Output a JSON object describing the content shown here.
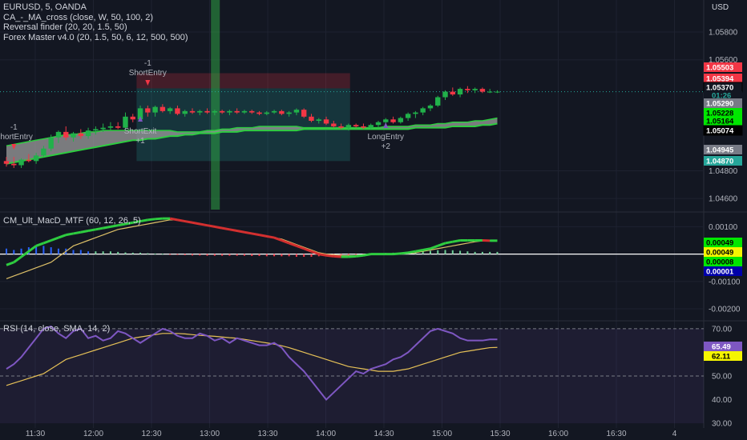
{
  "header": {
    "symbol_line": "EURUSD, 5, OANDA",
    "indicators": [
      "CA_-_MA_cross (close, W, 50, 100, 2)",
      "Reversal finder (20, 20, 1.5, 50)",
      "Forex Master v4.0 (20, 1.5, 50, 6, 12, 500, 500)"
    ],
    "currency": "USD"
  },
  "colors": {
    "background": "#131722",
    "bull": "#26a69a",
    "bull_candle": "#21b14a",
    "bear_candle": "#f23645",
    "macd_line": "#2ecc40",
    "signal_line": "#ddc068",
    "rsi_line": "#7e57c2",
    "rsi_ma": "#e6c157",
    "band_fill": "#9e9e9e",
    "grid": "#1e2230"
  },
  "chart_data": [
    {
      "type": "candlestick",
      "title": "EURUSD, 5, OANDA",
      "ylim": [
        1.0452,
        1.0595
      ],
      "y_ticks": [
        1.058,
        1.056,
        1.048,
        1.046
      ],
      "x_ticks": [
        "11:30",
        "12:00",
        "12:30",
        "13:00",
        "13:30",
        "14:00",
        "14:30",
        "15:00",
        "15:30",
        "16:00",
        "16:30",
        "4"
      ],
      "price_tags": [
        {
          "label": "1.05503",
          "value": 1.05503,
          "color": "#f23645"
        },
        {
          "label": "1.05394",
          "value": 1.05394,
          "color": "#f23645"
        },
        {
          "label": "1.05370",
          "value": 1.0537,
          "color": "#131722",
          "sub": "01:26"
        },
        {
          "label": "1.05290",
          "value": 1.0529,
          "color": "#787b86"
        },
        {
          "label": "1.05228",
          "value": 1.05228,
          "color": "#00e600"
        },
        {
          "label": "1.05164",
          "value": 1.05164,
          "color": "#00e600"
        },
        {
          "label": "1.05074",
          "value": 1.05074,
          "color": "#000000"
        },
        {
          "label": "1.04945",
          "value": 1.04945,
          "color": "#787b86"
        },
        {
          "label": "1.04870",
          "value": 1.0487,
          "color": "#26a69a"
        }
      ],
      "signals": [
        {
          "label": "-1",
          "label2": "ShortEntry",
          "time_index": 19,
          "kind": "sell"
        },
        {
          "label": "ShortExit",
          "label2": "+1",
          "time_index": 18,
          "kind": "exit"
        },
        {
          "label": "-1",
          "label2": "ShortEntry",
          "time_index": 1,
          "kind": "sell"
        },
        {
          "label": "LongEntry",
          "label2": "+2",
          "time_index": 51,
          "kind": "buy"
        }
      ],
      "ohlc": [
        [
          1.0487,
          1.049,
          1.0483,
          1.0485
        ],
        [
          1.0485,
          1.049,
          1.0482,
          1.0484
        ],
        [
          1.0484,
          1.0489,
          1.0482,
          1.0488
        ],
        [
          1.0488,
          1.0492,
          1.0486,
          1.0487
        ],
        [
          1.0487,
          1.0493,
          1.0485,
          1.0491
        ],
        [
          1.0491,
          1.0498,
          1.049,
          1.0496
        ],
        [
          1.0496,
          1.0506,
          1.0494,
          1.0504
        ],
        [
          1.0504,
          1.0509,
          1.05,
          1.0508
        ],
        [
          1.0508,
          1.0512,
          1.0502,
          1.0504
        ],
        [
          1.0504,
          1.0508,
          1.0501,
          1.0507
        ],
        [
          1.0507,
          1.051,
          1.0503,
          1.0505
        ],
        [
          1.0505,
          1.0511,
          1.0503,
          1.0509
        ],
        [
          1.0509,
          1.0512,
          1.0506,
          1.051
        ],
        [
          1.051,
          1.0514,
          1.0508,
          1.0511
        ],
        [
          1.0511,
          1.0515,
          1.0509,
          1.0512
        ],
        [
          1.0512,
          1.0515,
          1.051,
          1.0511
        ],
        [
          1.0511,
          1.0522,
          1.051,
          1.0519
        ],
        [
          1.0519,
          1.0521,
          1.0515,
          1.0517
        ],
        [
          1.0517,
          1.0527,
          1.0516,
          1.0525
        ],
        [
          1.0525,
          1.0527,
          1.0519,
          1.0522
        ],
        [
          1.0522,
          1.0527,
          1.0519,
          1.0526
        ],
        [
          1.0526,
          1.0528,
          1.0522,
          1.0523
        ],
        [
          1.0523,
          1.0526,
          1.0521,
          1.0525
        ],
        [
          1.0525,
          1.0527,
          1.052,
          1.0521
        ],
        [
          1.0521,
          1.0524,
          1.0519,
          1.0523
        ],
        [
          1.0523,
          1.0525,
          1.0521,
          1.0522
        ],
        [
          1.0522,
          1.0524,
          1.052,
          1.0523
        ],
        [
          1.0523,
          1.0525,
          1.0521,
          1.0522
        ],
        [
          1.0522,
          1.0524,
          1.052,
          1.0523
        ],
        [
          1.0523,
          1.0524,
          1.0521,
          1.0522
        ],
        [
          1.0522,
          1.0524,
          1.052,
          1.0523
        ],
        [
          1.0523,
          1.0525,
          1.0521,
          1.0522
        ],
        [
          1.0522,
          1.0524,
          1.0521,
          1.0523
        ],
        [
          1.0523,
          1.0524,
          1.0521,
          1.0522
        ],
        [
          1.0522,
          1.0523,
          1.052,
          1.0521
        ],
        [
          1.0521,
          1.0523,
          1.052,
          1.0522
        ],
        [
          1.0522,
          1.0524,
          1.0521,
          1.0523
        ],
        [
          1.0523,
          1.0524,
          1.052,
          1.0521
        ],
        [
          1.0521,
          1.0523,
          1.0519,
          1.0522
        ],
        [
          1.0522,
          1.0525,
          1.052,
          1.0524
        ],
        [
          1.0524,
          1.0525,
          1.0518,
          1.0519
        ],
        [
          1.0519,
          1.0521,
          1.0515,
          1.0516
        ],
        [
          1.0516,
          1.0518,
          1.0514,
          1.0517
        ],
        [
          1.0517,
          1.0519,
          1.0513,
          1.0514
        ],
        [
          1.0514,
          1.0516,
          1.0511,
          1.0512
        ],
        [
          1.0512,
          1.0514,
          1.051,
          1.0511
        ],
        [
          1.0511,
          1.0514,
          1.0509,
          1.0513
        ],
        [
          1.0513,
          1.0514,
          1.0511,
          1.0512
        ],
        [
          1.0512,
          1.0514,
          1.051,
          1.0511
        ],
        [
          1.0511,
          1.0514,
          1.051,
          1.0513
        ],
        [
          1.0513,
          1.0516,
          1.0511,
          1.0515
        ],
        [
          1.0515,
          1.0518,
          1.0513,
          1.0517
        ],
        [
          1.0517,
          1.0519,
          1.0514,
          1.0515
        ],
        [
          1.0515,
          1.0519,
          1.0514,
          1.0518
        ],
        [
          1.0518,
          1.0522,
          1.0516,
          1.0521
        ],
        [
          1.0521,
          1.0523,
          1.0518,
          1.0522
        ],
        [
          1.0522,
          1.0526,
          1.052,
          1.0525
        ],
        [
          1.0525,
          1.0528,
          1.0523,
          1.0527
        ],
        [
          1.0527,
          1.0534,
          1.0526,
          1.0533
        ],
        [
          1.0533,
          1.0538,
          1.0531,
          1.0537
        ],
        [
          1.0537,
          1.054,
          1.0534,
          1.0535
        ],
        [
          1.0535,
          1.054,
          1.0533,
          1.0539
        ],
        [
          1.0539,
          1.0541,
          1.0536,
          1.0538
        ],
        [
          1.0538,
          1.054,
          1.0536,
          1.0539
        ],
        [
          1.0539,
          1.054,
          1.0536,
          1.0537
        ],
        [
          1.0537,
          1.0539,
          1.0536,
          1.0537
        ],
        [
          1.0537,
          1.0538,
          1.0536,
          1.0537
        ]
      ],
      "band_upper": [
        1.0498,
        1.0499,
        1.05,
        1.0501,
        1.0502,
        1.0503,
        1.0504,
        1.0505,
        1.0506,
        1.0506,
        1.0507,
        1.0508,
        1.0508,
        1.0509,
        1.0509,
        1.0509,
        1.0509,
        1.0509,
        1.0509,
        1.0509,
        1.0509,
        1.0509,
        1.0509,
        1.0508,
        1.0508,
        1.0508,
        1.0508,
        1.0509,
        1.0509,
        1.051,
        1.051,
        1.0511,
        1.0511,
        1.0511,
        1.0512,
        1.0512,
        1.0512,
        1.0512,
        1.0512,
        1.0512,
        1.0511,
        1.0511,
        1.0511,
        1.0511,
        1.0511,
        1.0511,
        1.0511,
        1.0511,
        1.0511,
        1.0511,
        1.0511,
        1.0512,
        1.0512,
        1.0512,
        1.0512,
        1.0513,
        1.0513,
        1.0513,
        1.0514,
        1.0514,
        1.0515,
        1.0515,
        1.0515,
        1.0516,
        1.0516,
        1.0517,
        1.0518
      ],
      "band_lower": [
        1.0485,
        1.0486,
        1.0487,
        1.0488,
        1.0489,
        1.049,
        1.0491,
        1.0492,
        1.0493,
        1.0494,
        1.0495,
        1.0496,
        1.0497,
        1.0498,
        1.0499,
        1.05,
        1.0501,
        1.0502,
        1.0502,
        1.0503,
        1.0503,
        1.0504,
        1.0505,
        1.0505,
        1.0506,
        1.0506,
        1.0507,
        1.0507,
        1.0507,
        1.0508,
        1.0508,
        1.0508,
        1.0509,
        1.0509,
        1.0509,
        1.0509,
        1.0509,
        1.0509,
        1.0509,
        1.0509,
        1.051,
        1.051,
        1.051,
        1.051,
        1.051,
        1.051,
        1.051,
        1.051,
        1.051,
        1.051,
        1.051,
        1.051,
        1.051,
        1.051,
        1.051,
        1.0511,
        1.0511,
        1.0511,
        1.0511,
        1.0511,
        1.0512,
        1.0512,
        1.0512,
        1.0512,
        1.0513,
        1.0513,
        1.0514
      ]
    },
    {
      "type": "line",
      "title": "CM_Ult_MacD_MTF (60, 12, 26, 5)",
      "y_ticks": [
        "0.00100",
        "0.00000",
        "-0.00100",
        "-0.00200"
      ],
      "tick_values": [
        0.001,
        0,
        -0.001,
        -0.002
      ],
      "ylim": [
        -0.00235,
        0.00145
      ],
      "tags": [
        {
          "label": "0.00049",
          "value": 0.00049,
          "color": "#00e600"
        },
        {
          "label": "0.00049",
          "value": 0.00049,
          "color": "#f5f500",
          "text": "#000000"
        },
        {
          "label": "0.00008",
          "value": 8e-05,
          "color": "#00e600"
        },
        {
          "label": "0.00001",
          "value": 1e-05,
          "color": "#0000aa",
          "text": "#ffffff"
        }
      ],
      "macd": [
        -0.0004,
        -0.0003,
        -0.0001,
        0.0001,
        0.0003,
        0.0004,
        0.0005,
        0.0006,
        0.0007,
        0.00075,
        0.0008,
        0.00085,
        0.0009,
        0.00095,
        0.001,
        0.00105,
        0.0011,
        0.00115,
        0.0012,
        0.00125,
        0.00128,
        0.0013,
        0.0013,
        0.00125,
        0.0012,
        0.00115,
        0.0011,
        0.00105,
        0.001,
        0.00095,
        0.0009,
        0.00085,
        0.0008,
        0.00075,
        0.0007,
        0.00065,
        0.0006,
        0.0005,
        0.0004,
        0.0003,
        0.0002,
        0.0001,
        0.0,
        -5e-05,
        -8e-05,
        -0.0001,
        -0.0001,
        -8e-05,
        -5e-05,
        0.0,
        0.0,
        0.0,
        0.0,
        2e-05,
        5e-05,
        0.0001,
        0.00015,
        0.0002,
        0.0003,
        0.0004,
        0.00045,
        0.0005,
        0.0005,
        0.0005,
        0.0005,
        0.00049,
        0.00049
      ],
      "signal": [
        -0.0009,
        -0.0008,
        -0.0007,
        -0.0006,
        -0.0005,
        -0.0004,
        -0.0003,
        -0.0001,
        0.0001,
        0.0003,
        0.0004,
        0.0005,
        0.0006,
        0.0007,
        0.0008,
        0.0009,
        0.00095,
        0.001,
        0.00105,
        0.0011,
        0.00115,
        0.0012,
        0.00125,
        0.00125,
        0.0012,
        0.00115,
        0.0011,
        0.00105,
        0.001,
        0.00095,
        0.0009,
        0.00085,
        0.0008,
        0.00075,
        0.0007,
        0.00065,
        0.0006,
        0.00055,
        0.00045,
        0.00035,
        0.00025,
        0.00015,
        5e-05,
        0.0,
        -3e-05,
        -5e-05,
        -6e-05,
        -5e-05,
        -3e-05,
        0.0,
        0.0,
        0.0,
        0.0,
        1e-05,
        2e-05,
        5e-05,
        0.0001,
        0.00015,
        0.0002,
        0.00025,
        0.0003,
        0.00035,
        0.0004,
        0.00045,
        0.00048,
        0.00049,
        0.00049
      ],
      "hist": [
        0.0002,
        0.00015,
        0.0002,
        0.00025,
        0.0003,
        0.0003,
        0.00025,
        0.0002,
        0.0002,
        0.00015,
        0.00015,
        0.0001,
        0.0001,
        0.0001,
        0.0001,
        8e-05,
        6e-05,
        5e-05,
        5e-05,
        3e-05,
        2e-05,
        1e-05,
        -2e-05,
        -3e-05,
        -4e-05,
        -5e-05,
        -5e-05,
        -6e-05,
        -6e-05,
        -6e-05,
        -6e-05,
        -6e-05,
        -6e-05,
        -7e-05,
        -7e-05,
        -8e-05,
        -8e-05,
        -8e-05,
        -8e-05,
        -0.0001,
        -0.0001,
        -0.0001,
        -8e-05,
        -8e-05,
        -6e-05,
        -5e-05,
        -4e-05,
        -3e-05,
        -2e-05,
        2e-05,
        3e-05,
        4e-05,
        5e-05,
        6e-05,
        8e-05,
        0.0001,
        0.0001,
        0.00012,
        0.00014,
        0.00015,
        0.00014,
        0.00012,
        0.0001,
        8e-05,
        8e-05,
        8e-05,
        8e-05
      ]
    },
    {
      "type": "line",
      "title": "RSI (14, close, SMA, 14, 2)",
      "ylim": [
        28,
        72
      ],
      "y_ticks": [
        "70.00",
        "60.00",
        "50.00",
        "40.00",
        "30.00"
      ],
      "tick_values": [
        70,
        60,
        50,
        40,
        30
      ],
      "tags": [
        {
          "label": "65.49",
          "value": 65.49,
          "color": "#7e57c2",
          "text": "#ffffff"
        },
        {
          "label": "62.11",
          "value": 62.11,
          "color": "#f5f500",
          "text": "#000000"
        }
      ],
      "rsi": [
        53,
        55,
        58,
        62,
        66,
        70,
        71,
        68,
        66,
        69,
        70,
        66,
        67,
        65,
        66,
        69,
        68,
        66,
        64,
        66,
        68,
        70,
        69,
        67,
        66,
        66,
        68,
        67,
        65,
        66,
        64,
        66,
        65,
        64,
        63,
        63,
        64,
        62,
        58,
        55,
        52,
        48,
        44,
        40,
        43,
        46,
        49,
        52,
        51,
        53,
        54,
        55,
        57,
        58,
        60,
        63,
        66,
        69,
        70,
        69,
        68,
        66,
        65,
        65,
        65,
        65.49,
        65.49
      ],
      "rsi_ma": [
        46,
        47,
        48,
        49,
        50,
        51,
        53,
        55,
        57,
        58,
        59,
        60,
        61,
        62,
        63,
        64,
        65,
        66,
        66.5,
        67,
        67.5,
        68,
        68,
        68,
        67.8,
        67.5,
        67.2,
        67,
        66.8,
        66.5,
        66.2,
        66,
        65.5,
        65,
        64.5,
        64,
        63.5,
        62.8,
        62,
        61,
        60,
        59,
        58,
        57,
        56,
        55,
        54,
        53.5,
        53,
        52.5,
        52,
        52,
        52,
        52.5,
        53,
        54,
        55,
        56,
        57,
        58,
        59,
        60,
        60.5,
        61,
        61.5,
        62,
        62.11
      ]
    }
  ]
}
